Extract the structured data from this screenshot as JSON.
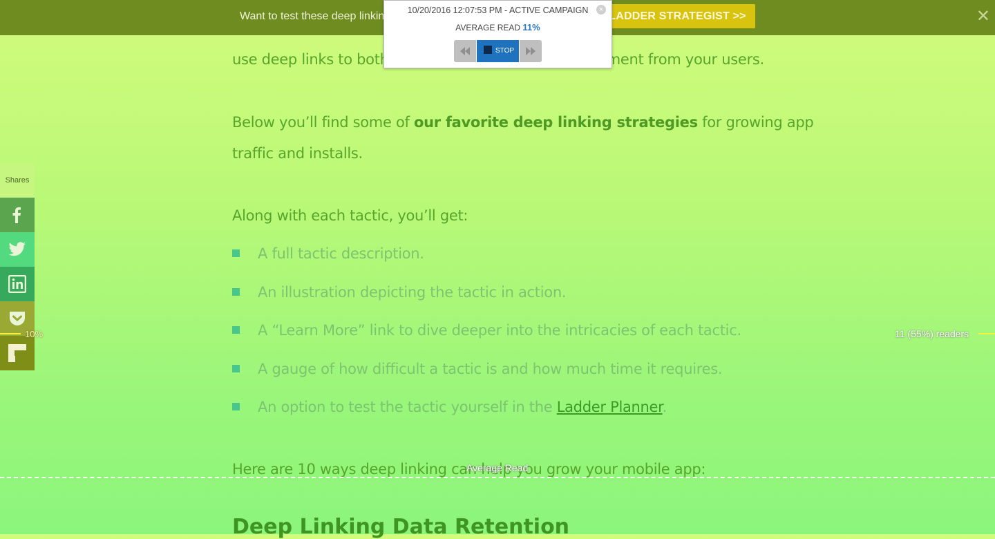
{
  "topbar": {
    "promo_text": "Want to test these deep linking",
    "cta_label": "LADDER STRATEGIST >>",
    "close_glyph": "✕"
  },
  "article": {
    "line1": "use deep links to both d",
    "line1_tail": "gement from your users.",
    "para2_start": "Below you’ll find some of ",
    "para2_bold": "our favorite deep linking strategies",
    "para2_end": " for growing app",
    "para2_line2": "traffic and installs.",
    "para3": "Along with each tactic, you’ll get:",
    "list": [
      "A full tactic description.",
      "An illustration depicting the tactic in action.",
      "A “Learn More” link to dive deeper into the intricacies of each tactic.",
      "A gauge of how difficult a tactic is and how much time it requires."
    ],
    "last_item_prefix": "An option to test the tactic yourself in the ",
    "last_item_link": "Ladder Planner",
    "last_item_suffix": ".",
    "para4": "Here are 10 ways deep linking can help you grow your mobile app:",
    "heading": "Deep Linking Data Retention"
  },
  "shares": {
    "label": "Shares",
    "buttons": [
      {
        "name": "facebook",
        "color": "#5aa54e"
      },
      {
        "name": "twitter",
        "color": "#53d97e"
      },
      {
        "name": "linkedin",
        "color": "#37a95c"
      },
      {
        "name": "pocket",
        "color": "#9aa834"
      },
      {
        "name": "flipboard",
        "color": "#7e8e16"
      }
    ]
  },
  "overlay": {
    "avg_read_label": "Average Read",
    "scroll_pct": "10%",
    "readers": "11 (55%) readers"
  },
  "popup": {
    "timestamp": "10/20/2016 12:07:53 PM - ACTIVE CAMPAIGN",
    "avg_label": "AVERAGE READ",
    "avg_value": "11%",
    "stop_label": "STOP",
    "close_glyph": "×"
  }
}
